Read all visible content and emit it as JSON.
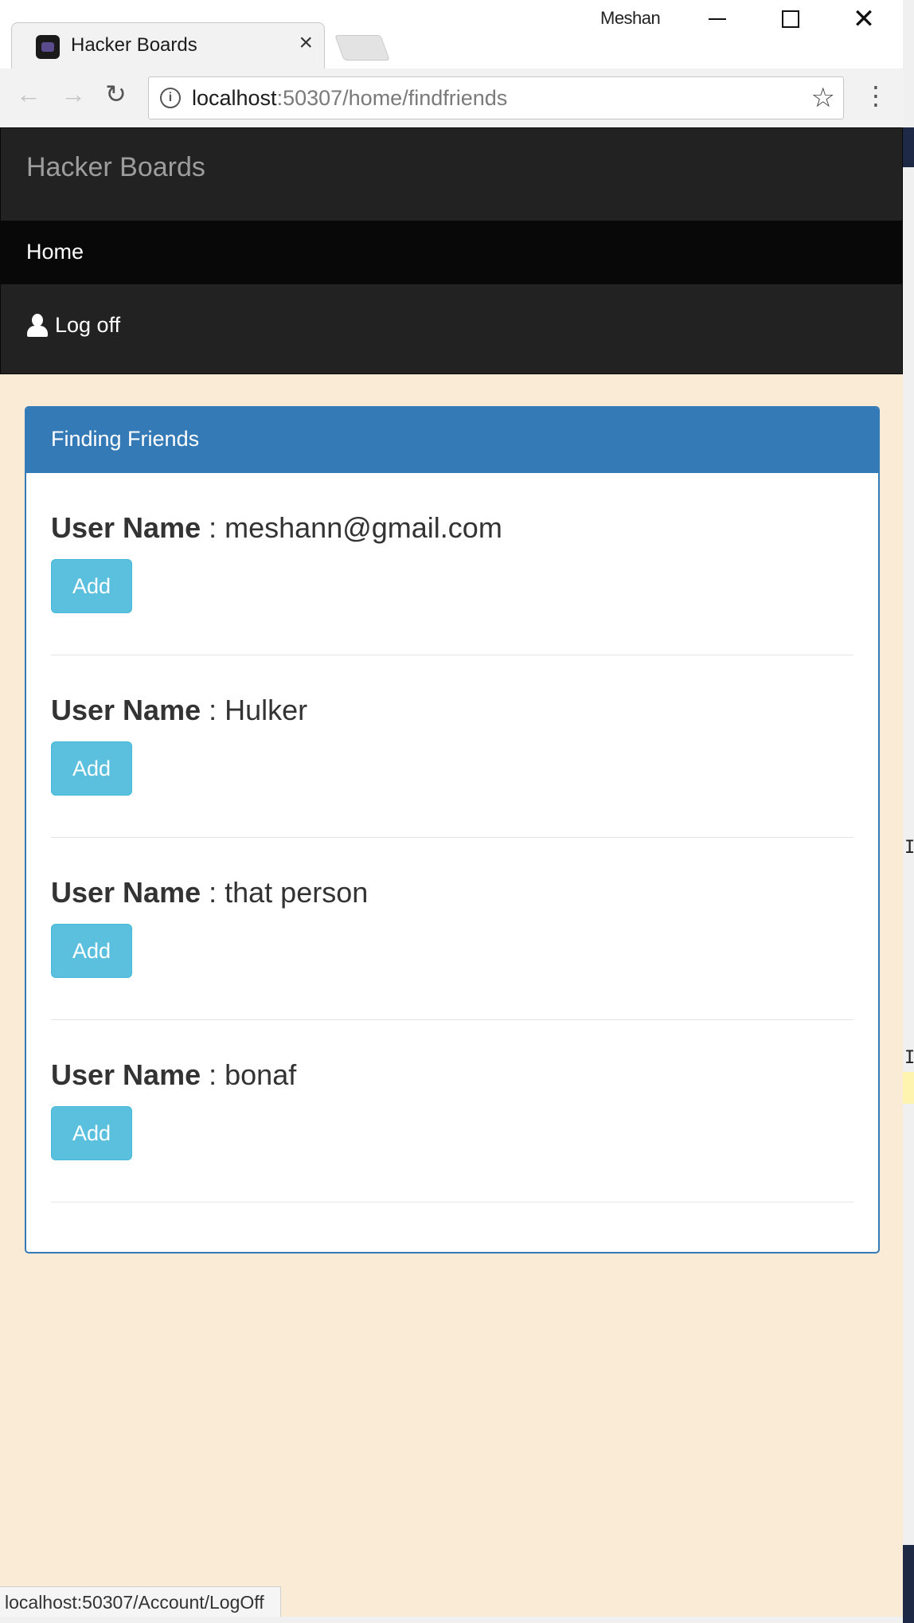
{
  "browser": {
    "tab_title": "Hacker Boards",
    "tab_close": "×",
    "profile_name": "Meshan",
    "url_host": "localhost",
    "url_rest": ":50307/home/findfriends",
    "status_url": "localhost:50307/Account/LogOff",
    "icons": {
      "back": "back-arrow-icon",
      "forward": "forward-arrow-icon",
      "reload": "reload-icon",
      "info": "info-icon",
      "star": "star-icon",
      "menu": "kebab-menu-icon",
      "minimize": "minimize-icon",
      "maximize": "maximize-icon",
      "close": "close-icon"
    },
    "glyphs": {
      "back": "←",
      "forward": "→",
      "reload": "↻",
      "info": "i",
      "star": "☆",
      "menu": "⋮",
      "close": "✕"
    }
  },
  "page": {
    "brand": "Hacker Boards",
    "nav": {
      "home": "Home",
      "logoff": "Log off"
    },
    "panel_title": "Finding Friends",
    "users": [
      {
        "label": "User Name",
        "separator": " : ",
        "name": "meshann@gmail.com",
        "button": "Add"
      },
      {
        "label": "User Name",
        "separator": " : ",
        "name": "Hulker",
        "button": "Add"
      },
      {
        "label": "User Name",
        "separator": " : ",
        "name": "that person",
        "button": "Add"
      },
      {
        "label": "User Name",
        "separator": " : ",
        "name": "bonaf",
        "button": "Add"
      }
    ]
  },
  "colors": {
    "page_background": "#faebd7",
    "navbar": "#222222",
    "navbar_active": "#080808",
    "panel_primary": "#337ab7",
    "button_info": "#5bc0de"
  },
  "edge": {
    "mark": "I"
  }
}
